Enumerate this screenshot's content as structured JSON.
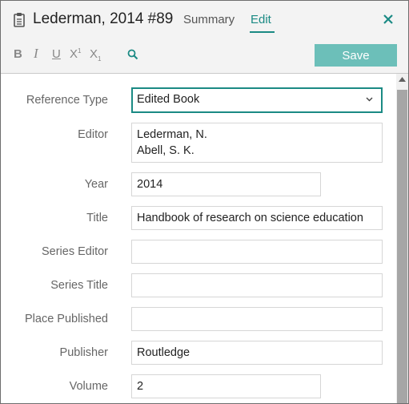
{
  "header": {
    "title": "Lederman, 2014 #89",
    "tabs": [
      {
        "label": "Summary"
      },
      {
        "label": "Edit"
      }
    ],
    "active_tab": "Edit",
    "accent_color": "#1b8a84"
  },
  "toolbar": {
    "bold": "B",
    "italic": "I",
    "underline": "U",
    "superscript_base": "X",
    "superscript_mark": "1",
    "subscript_base": "X",
    "subscript_mark": "1",
    "save_label": "Save",
    "save_color": "#6cbfb9",
    "icons": [
      "clipboard-icon",
      "close-icon",
      "search-icon",
      "chevron-down-icon"
    ]
  },
  "form": {
    "reference_type": {
      "label": "Reference Type",
      "value": "Edited Book"
    },
    "editor": {
      "label": "Editor",
      "lines": [
        "Lederman, N.",
        "Abell, S. K."
      ]
    },
    "year": {
      "label": "Year",
      "value": "2014"
    },
    "title": {
      "label": "Title",
      "value": "Handbook of research on science education"
    },
    "series_editor": {
      "label": "Series Editor",
      "value": ""
    },
    "series_title": {
      "label": "Series Title",
      "value": ""
    },
    "place_published": {
      "label": "Place Published",
      "value": ""
    },
    "publisher": {
      "label": "Publisher",
      "value": "Routledge"
    },
    "volume": {
      "label": "Volume",
      "value": "2"
    }
  }
}
